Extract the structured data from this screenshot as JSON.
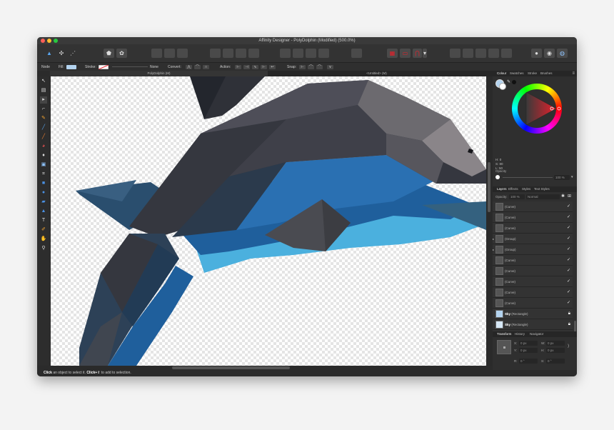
{
  "window": {
    "title": "Affinity Designer - PolyDolphin (Modified) (500.0%)"
  },
  "context_bar": {
    "tool_label": "Node",
    "fill_label": "Fill:",
    "stroke_label": "Stroke:",
    "stroke_value": "None",
    "convert_label": "Convert:",
    "action_label": "Action:",
    "snap_label": "Snap:"
  },
  "doc_tabs": [
    {
      "label": "PolyDolphin (M)"
    },
    {
      "label": "<Untitled> (M)"
    }
  ],
  "color_panel": {
    "tabs": [
      "Colour",
      "Swatches",
      "Stroke",
      "Brushes"
    ],
    "hsl": {
      "h": "H: 0",
      "s": "S: 80",
      "l": "L: 50"
    },
    "opacity_label": "Opacity",
    "opacity_value": "100 %"
  },
  "layers_panel": {
    "tabs": [
      "Layers",
      "Effects",
      "Styles",
      "Text Styles"
    ],
    "opacity_label": "Opacity:",
    "opacity_value": "100 %",
    "blend_mode": "Normal",
    "rows": [
      {
        "name": "",
        "type": "(Curve)"
      },
      {
        "name": "",
        "type": "(Curve)"
      },
      {
        "name": "",
        "type": "(Curve)"
      },
      {
        "name": "",
        "type": "(Group)"
      },
      {
        "name": "",
        "type": "(Group)"
      },
      {
        "name": "",
        "type": "(Curve)"
      },
      {
        "name": "",
        "type": "(Curve)"
      },
      {
        "name": "",
        "type": "(Curve)"
      },
      {
        "name": "",
        "type": "(Curve)"
      },
      {
        "name": "",
        "type": "(Curve)"
      },
      {
        "name": "Sky",
        "type": "(Rectangle)"
      },
      {
        "name": "Sky",
        "type": "(Rectangle)"
      },
      {
        "name": "Sea",
        "type": "(Rectangle)"
      },
      {
        "name": "Background",
        "type": "(Pixel)"
      }
    ]
  },
  "transform_panel": {
    "tabs": [
      "Transform",
      "History",
      "Navigator"
    ],
    "x_label": "X:",
    "x_value": "0 px",
    "y_label": "Y:",
    "y_value": "0 px",
    "w_label": "W:",
    "w_value": "0 px",
    "h_label": "H:",
    "h_value": "0 px",
    "r_label": "R:",
    "r_value": "0 °",
    "s_label": "S:",
    "s_value": "0 °"
  },
  "status_bar": {
    "click_bold": "Click",
    "click_text": " an object to select it. ",
    "modifier_bold": "Click+⇧",
    "modifier_text": " to add to selection."
  },
  "colors": {
    "dolphin_dark": "#35373f",
    "dolphin_grey": "#6c6a6f",
    "dolphin_blue": "#2065a5",
    "dolphin_light_blue": "#4bb0de",
    "fill_swatch": "#b3d3ef",
    "accent_red": "#e8202b"
  }
}
